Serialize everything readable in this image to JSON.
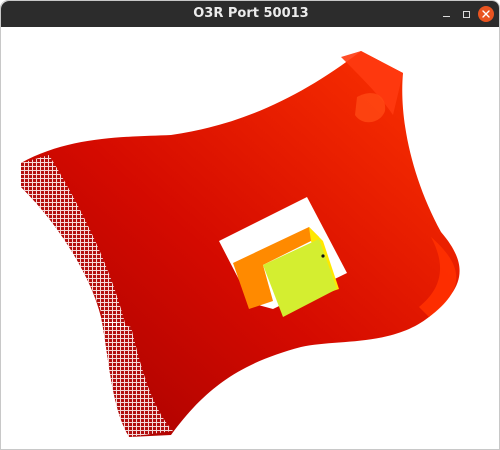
{
  "window": {
    "title": "O3R Port 50013"
  },
  "controls": {
    "minimize_icon": "minimize-icon",
    "maximize_icon": "maximize-icon",
    "close_icon": "close-icon"
  },
  "colors": {
    "titlebar": "#2c2c2c",
    "close_button": "#e95420",
    "far_surface": "#ff2a00",
    "near_surface": "#b80000",
    "box_outer": "#ff8c00",
    "box_top": "#d6f032",
    "box_edge": "#ffe600"
  }
}
